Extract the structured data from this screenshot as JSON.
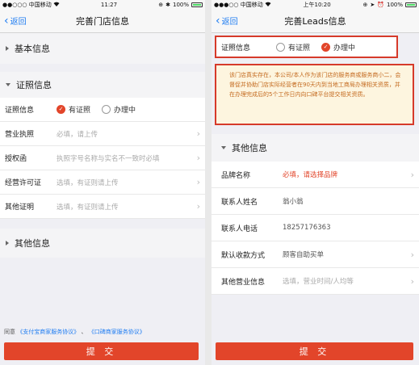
{
  "left": {
    "status": {
      "carrier": "●●○○○ 中国移动",
      "wifi": "WiFi",
      "time": "11:27",
      "battery": "100%"
    },
    "nav": {
      "back": "返回",
      "title": "完善门店信息"
    },
    "sections": {
      "basic": "基本信息",
      "cert": "证照信息",
      "other": "其他信息"
    },
    "cert_status": {
      "label": "证照信息",
      "opt_yes": "有证照",
      "opt_processing": "办理中"
    },
    "fields": [
      {
        "label": "营业执照",
        "placeholder": "必填，请上传"
      },
      {
        "label": "授权函",
        "placeholder": "执照字号名称与实名不一致时必填"
      },
      {
        "label": "经营许可证",
        "placeholder": "选填，有证则请上传"
      },
      {
        "label": "其他证明",
        "placeholder": "选填，有证则请上传"
      }
    ],
    "agreement": {
      "prefix": "同意",
      "link1": "《支付宝商家服务协议》",
      "sep": "、",
      "link2": "《口碑商家服务协议》"
    },
    "submit": "提 交"
  },
  "right": {
    "status": {
      "carrier": "●●●○○ 中国移动",
      "wifi": "WiFi",
      "time": "上午10:20",
      "battery": "100%"
    },
    "nav": {
      "back": "返回",
      "title": "完善Leads信息"
    },
    "cert_status": {
      "label": "证照信息",
      "opt_yes": "有证照",
      "opt_processing": "办理中"
    },
    "notice": "该门店真实存在，本公司/本人作为该门店的服务商或服务商小二，会督促并协助门店实际经营者在90天内到当地工商局办理相关资质，并在办理完成后的5个工作日内向口碑平台提交相关资质。",
    "other_section": "其他信息",
    "fields": [
      {
        "label": "品牌名称",
        "value": "必填，请选择品牌"
      },
      {
        "label": "联系人姓名",
        "value": "翁小翁"
      },
      {
        "label": "联系人电话",
        "value": "18257176363"
      },
      {
        "label": "默认收款方式",
        "value": "顾客自助买单"
      },
      {
        "label": "其他营业信息",
        "value": "选填，营业时间/人均等"
      }
    ],
    "submit": "提 交"
  }
}
